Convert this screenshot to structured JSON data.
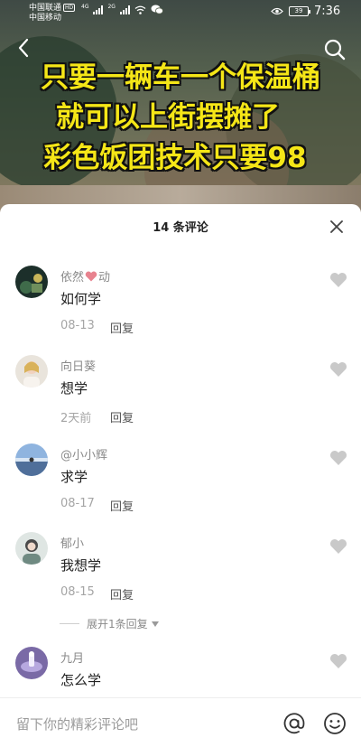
{
  "status_bar": {
    "carrier_1": "中国联通",
    "carrier_1_badge": "HD",
    "carrier_2": "中国移动",
    "signal_1_label": "4G",
    "signal_2_label": "2G",
    "battery": "39",
    "time": "7:36"
  },
  "video": {
    "caption_lines": [
      "只要一辆车一个保温桶",
      "就可以上街摆摊了",
      "彩色饭团技术只要98"
    ],
    "caption_color": "#f5e617"
  },
  "comments_panel": {
    "title": "14 条评论",
    "reply_label": "回复",
    "expand_label": "展开1条回复",
    "comments": [
      {
        "user_before": "依然",
        "user_after": "动",
        "heart_in_name": true,
        "text": "如何学",
        "date": "08-13"
      },
      {
        "user": "向日葵",
        "text": "想学",
        "date": "2天前"
      },
      {
        "user": "@小小辉",
        "text": "求学",
        "date": "08-17"
      },
      {
        "user": "郁小",
        "text": "我想学",
        "date": "08-15"
      },
      {
        "user": "九月",
        "text": "怎么学",
        "date": ""
      }
    ]
  },
  "input_bar": {
    "placeholder": "留下你的精彩评论吧"
  },
  "icons": {
    "back": "chevron-left-icon",
    "search": "search-icon",
    "close": "close-icon",
    "like": "heart-icon",
    "mention": "at-icon",
    "emoji": "emoji-icon"
  },
  "colors": {
    "username": "#8a8a8a",
    "meta": "#a5a5a5",
    "like_icon": "#c9c9c9",
    "name_heart": "#e8838f"
  }
}
